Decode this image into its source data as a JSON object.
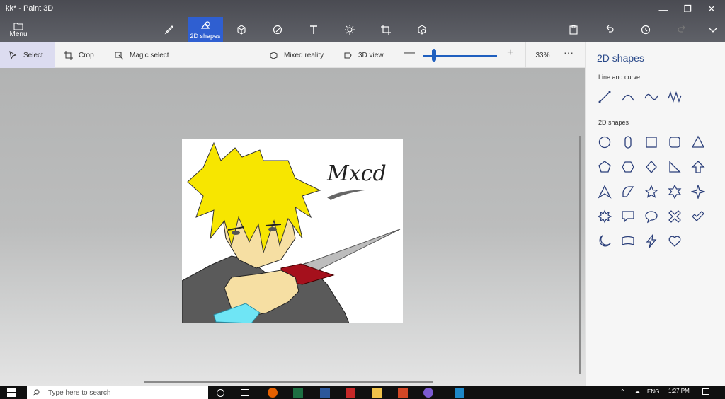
{
  "window": {
    "title": "kk* - Paint 3D"
  },
  "menu": {
    "label": "Menu"
  },
  "tools": {
    "active_label": "2D shapes"
  },
  "toolbar2": {
    "select": "Select",
    "crop": "Crop",
    "magic_select": "Magic select",
    "mixed_reality": "Mixed reality",
    "view_3d": "3D view",
    "zoom": "33%",
    "zoom_level": 0.33
  },
  "canvas": {
    "signature": "Mxcd"
  },
  "side_panel": {
    "title": "2D shapes",
    "section_lines": "Line and curve",
    "section_shapes": "2D shapes"
  },
  "taskbar": {
    "search_placeholder": "Type here to search",
    "language": "ENG",
    "time": "1:27 PM"
  },
  "colors": {
    "accent": "#2f5fd1",
    "panel_title": "#2b4a8a",
    "icon": "#2b3f7a"
  }
}
